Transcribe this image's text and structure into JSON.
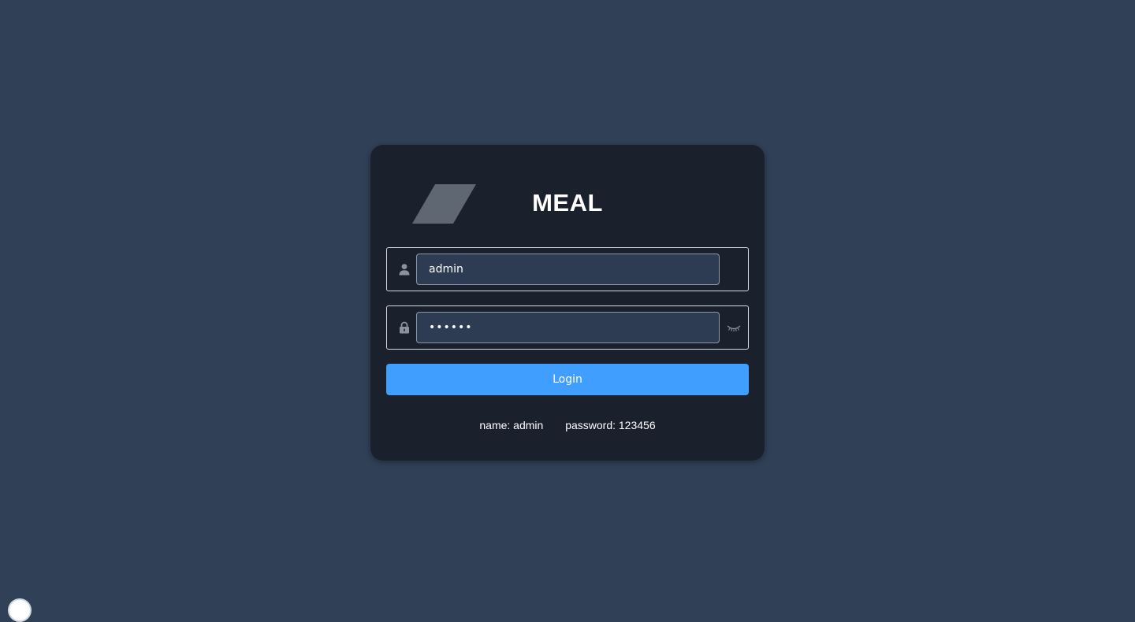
{
  "brand": {
    "title": "MEAL",
    "logo_icon": "parallelogram-logo",
    "logo_color": "#5f6772"
  },
  "form": {
    "username": {
      "icon": "user-icon",
      "value": "admin",
      "placeholder": ""
    },
    "password": {
      "icon": "lock-icon",
      "value": "123456",
      "placeholder": "",
      "toggle_icon": "eye-closed-icon"
    },
    "login_label": "Login"
  },
  "hint": {
    "name": "name: admin",
    "password": "password: 123456"
  },
  "colors": {
    "background": "#304057",
    "card": "#1a212c",
    "accent": "#409eff",
    "input_fill": "#2d3c52"
  }
}
